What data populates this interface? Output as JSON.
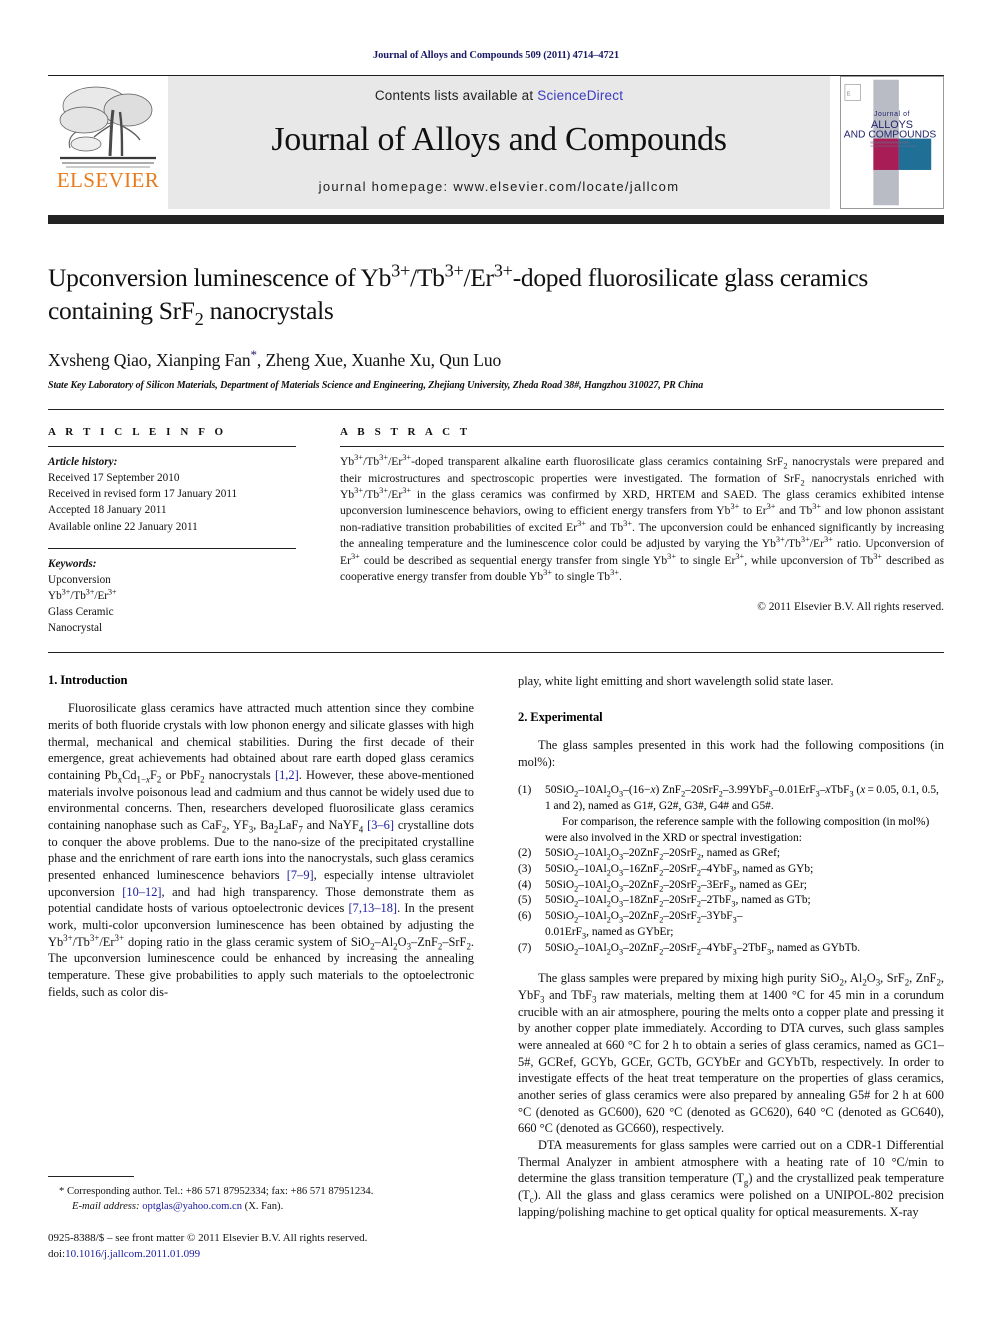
{
  "running_head": "Journal of Alloys and Compounds 509 (2011) 4714–4721",
  "masthead": {
    "contents_prefix": "Contents lists available at ",
    "sciencedirect": "ScienceDirect",
    "journal_title": "Journal of Alloys and Compounds",
    "homepage_label": "journal homepage:",
    "homepage_url": "www.elsevier.com/locate/jallcom",
    "publisher_wordmark": "ELSEVIER",
    "publisher_color": "#e87b1e",
    "link_color": "#3b3bc2",
    "cover_line1": "Journal of",
    "cover_line2": "ALLOYS",
    "cover_line3": "AND COMPOUNDS"
  },
  "title": {
    "line1_a": "Upconversion luminescence of Yb",
    "line1_sup1": "3+",
    "line1_b": "/Tb",
    "line1_sup2": "3+",
    "line1_c": "/Er",
    "line1_sup3": "3+",
    "line1_d": "-doped fluorosilicate glass ceramics",
    "line2_a": "containing SrF",
    "line2_sub": "2",
    "line2_b": " nanocrystals"
  },
  "authors": {
    "list": "Xvsheng Qiao, Xianping Fan",
    "corresponding_marker": "*",
    "rest": ", Zheng Xue, Xuanhe Xu, Qun Luo",
    "affiliation": "State Key Laboratory of Silicon Materials, Department of Materials Science and Engineering, Zhejiang University, Zheda Road 38#, Hangzhou 310027, PR China"
  },
  "article_info": {
    "heading": "A R T I C L E  I N F O",
    "history_label": "Article history:",
    "history": [
      "Received 17 September 2010",
      "Received in revised form 17 January 2011",
      "Accepted 18 January 2011",
      "Available online 22 January 2011"
    ],
    "keywords_label": "Keywords:",
    "keywords": [
      "Upconversion",
      "Yb3+/Tb3+/Er3+",
      "Glass Ceramic",
      "Nanocrystal"
    ]
  },
  "abstract": {
    "heading": "A B S T R A C T",
    "text": "Yb3+/Tb3+/Er3+-doped transparent alkaline earth fluorosilicate glass ceramics containing SrF2 nanocrystals were prepared and their microstructures and spectroscopic properties were investigated. The formation of SrF2 nanocrystals enriched with Yb3+/Tb3+/Er3+ in the glass ceramics was confirmed by XRD, HRTEM and SAED. The glass ceramics exhibited intense upconversion luminescence behaviors, owing to efficient energy transfers from Yb3+ to Er3+ and Tb3+ and low phonon assistant non-radiative transition probabilities of excited Er3+ and Tb3+. The upconversion could be enhanced significantly by increasing the annealing temperature and the luminescence color could be adjusted by varying the Yb3+/Tb3+/Er3+ ratio. Upconversion of Er3+ could be described as sequential energy transfer from single Yb3+ to single Er3+, while upconversion of Tb3+ described as cooperative energy transfer from double Yb3+ to single Tb3+.",
    "copyright": "© 2011 Elsevier B.V. All rights reserved."
  },
  "sections": {
    "introduction_heading": "1.  Introduction",
    "experimental_heading": "2.  Experimental",
    "intro_p1": "Fluorosilicate glass ceramics have attracted much attention since they combine merits of both fluoride crystals with low phonon energy and silicate glasses with high thermal, mechanical and chemical stabilities. During the first decade of their emergence, great achievements had obtained about rare earth doped glass ceramics containing PbxCd1−xF2 or PbF2 nanocrystals [1,2]. However, these above-mentioned materials involve poisonous lead and cadmium and thus cannot be widely used due to environmental concerns. Then, researchers developed fluorosilicate glass ceramics containing nanophase such as CaF2, YF3, Ba2LaF7 and NaYF4 [3–6] crystalline dots to conquer the above problems. Due to the nano-size of the precipitated crystalline phase and the enrichment of rare earth ions into the nanocrystals, such glass ceramics presented enhanced luminescence behaviors [7–9], especially intense ultraviolet upconversion [10–12], and had high transparency. Those demonstrate them as potential candidate hosts of various optoelectronic devices [7,13–18]. In the present work, multi-color upconversion luminescence has been obtained by adjusting the Yb3+/Tb3+/Er3+ doping ratio in the glass ceramic system of SiO2–Al2O3–ZnF2–SrF2. The upconversion luminescence could be enhanced by increasing the annealing temperature. These give probabilities to apply such materials to the optoelectronic fields, such as color display, white light emitting and short wavelength solid state laser.",
    "exp_p1": "The glass samples presented in this work had the following compositions (in mol%):",
    "compositions": [
      {
        "num": "(1)",
        "text": "50SiO2–10Al2O3–(16−x) ZnF2–20SrF2–3.99YbF3–0.01ErF3–xTbF3 (x = 0.05, 0.1, 0.5, 1 and 2), named as G1#, G2#, G3#, G4# and G5#.",
        "sub": "For comparison, the reference sample with the following composition (in mol%) were also involved in the XRD or spectral investigation:"
      },
      {
        "num": "(2)",
        "text": "50SiO2–10Al2O3–20ZnF2–20SrF2, named as GRef;",
        "sub": ""
      },
      {
        "num": "(3)",
        "text": "50SiO2–10Al2O3–16ZnF2–20SrF2–4YbF3, named as GYb;",
        "sub": ""
      },
      {
        "num": "(4)",
        "text": "50SiO2–10Al2O3–20ZnF2–20SrF2–3ErF3, named as GEr;",
        "sub": ""
      },
      {
        "num": "(5)",
        "text": "50SiO2–10Al2O3–18ZnF2–20SrF2–2TbF3, named as GTb;",
        "sub": ""
      },
      {
        "num": "(6)",
        "text": "50SiO2–10Al2O3–20ZnF2–20SrF2–3YbF3–",
        "sub": "0.01ErF3, named as GYbEr;"
      },
      {
        "num": "(7)",
        "text": "50SiO2–10Al2O3–20ZnF2–20SrF2–4YbF3–2TbF3, named as GYbTb.",
        "sub": ""
      }
    ],
    "exp_p2": "The glass samples were prepared by mixing high purity SiO2, Al2O3, SrF2, ZnF2, YbF3 and TbF3 raw materials, melting them at 1400 °C for 45 min in a corundum crucible with an air atmosphere, pouring the melts onto a copper plate and pressing it by another copper plate immediately. According to DTA curves, such glass samples were annealed at 660 °C for 2 h to obtain a series of glass ceramics, named as GC1–5#, GCRef, GCYb, GCEr, GCTb, GCYbEr and GCYbTb, respectively. In order to investigate effects of the heat treat temperature on the properties of glass ceramics, another series of glass ceramics were also prepared by annealing G5# for 2 h at 600 °C (denoted as GC600), 620 °C (denoted as GC620), 640 °C (denoted as GC640), 660 °C (denoted as GC660), respectively.",
    "exp_p3": "DTA measurements for glass samples were carried out on a CDR-1 Differential Thermal Analyzer in ambient atmosphere with a heating rate of 10 °C/min to determine the glass transition temperature (Tg) and the crystallized peak temperature (Tc). All the glass and glass ceramics were polished on a UNIPOL-802 precision lapping/polishing machine to get optical quality for optical measurements. X-ray"
  },
  "footnotes": {
    "corresponding": "* Corresponding author. Tel.: +86 571 87952334; fax: +86 571 87951234.",
    "email_label": "E-mail address:",
    "email": "optglas@yahoo.com.cn",
    "email_suffix": " (X. Fan).",
    "issn_line": "0925-8388/$ – see front matter © 2011 Elsevier B.V. All rights reserved.",
    "doi_label": "doi:",
    "doi": "10.1016/j.jallcom.2011.01.099"
  }
}
